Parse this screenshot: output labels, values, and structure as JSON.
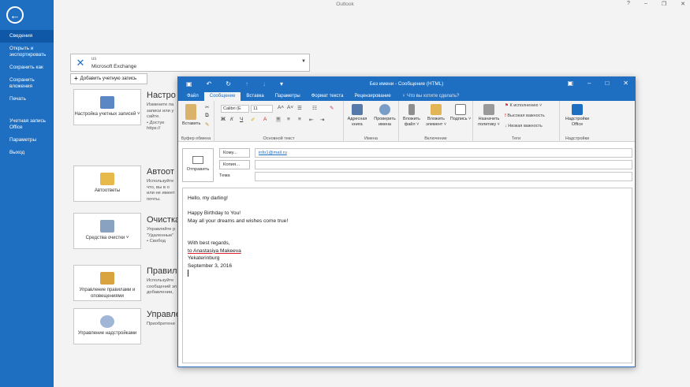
{
  "window": {
    "app_title": "Outlook",
    "controls": [
      "?",
      "–",
      "❐",
      "✕"
    ]
  },
  "nav": {
    "back_glyph": "←",
    "items": [
      {
        "label": "Сведения",
        "active": true
      },
      {
        "label": "Открыть и экспортировать",
        "active": false
      },
      {
        "label": "Сохранить как",
        "active": false
      },
      {
        "label": "Сохранить вложения",
        "active": false
      },
      {
        "label": "Печать",
        "active": false
      },
      {
        "label": "Учетная запись Office",
        "active": false
      },
      {
        "label": "Параметры",
        "active": false
      },
      {
        "label": "Выход",
        "active": false
      }
    ]
  },
  "backstage": {
    "account_select": {
      "line1": "us",
      "line2": "Microsoft Exchange"
    },
    "add_account": "Добавить учетную запись",
    "tiles": [
      {
        "label": "Настройка учетных записей ˅"
      },
      {
        "label": "Автоответы"
      },
      {
        "label": "Средства очистки ˅"
      },
      {
        "label": "Управление правилами и оповещениями"
      },
      {
        "label": "Управление надстройками"
      }
    ],
    "sections": [
      {
        "heading": "Настро",
        "text": "Измените па записи или у сайте.\n• Достуе\nhttps://"
      },
      {
        "heading": "Автоот",
        "text": "Используйте что, вы в о или не имеет почты."
      },
      {
        "heading": "Очистка",
        "text": "Управляйте р \"Удаленные\"\n• Свобод"
      },
      {
        "heading": "Правила",
        "text": "Используйте сообщений эл добавлении,"
      },
      {
        "heading": "Управле",
        "text": "Приобретени"
      }
    ]
  },
  "compose": {
    "title": "Без имени - Сообщение (HTML)",
    "tabs": [
      "Файл",
      "Сообщение",
      "Вставка",
      "Параметры",
      "Формат текста",
      "Рецензирование"
    ],
    "active_tab": "Сообщение",
    "tell_me": "♀ Что вы хотите сделать?",
    "ribbon": {
      "groups": [
        "Буфер обмена",
        "Основной текст",
        "Имена",
        "Включение",
        "Теги",
        "Надстройки"
      ],
      "paste_label": "Вставить",
      "font_name": "Calibri (E",
      "font_size": "11",
      "names_buttons": [
        "Адресная книга",
        "Проверить имена"
      ],
      "include_buttons": [
        "Вложить файл ˅",
        "Вложить элемент ˅",
        "Подпись ˅"
      ],
      "assign_policy": "Назначить политику ˅",
      "tags": [
        "К исполнению ˅",
        "Высокая важность",
        "Низкая важность"
      ],
      "addins_button": "Надстройки Office"
    },
    "send_label": "Отправить",
    "to_label": "Кому...",
    "cc_label": "Копия...",
    "subject_label": "Тема",
    "to_value": "info1@mail.ru",
    "body_lines": [
      "Hello, my darling!",
      "",
      "Happy Birthday to You!",
      "May all your dreams and wishes come true!",
      "",
      "",
      "With best regards,",
      "to Anastasiya Makeeva",
      "Yekaterinburg",
      "September 3, 2016"
    ]
  }
}
